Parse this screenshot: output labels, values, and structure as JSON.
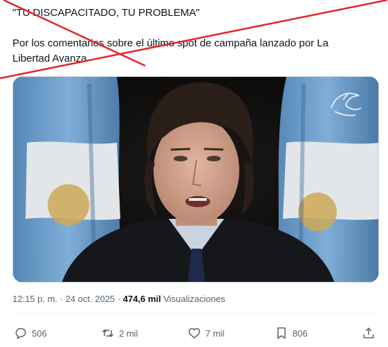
{
  "tweet": {
    "line1": "\"TU DISCAPACITADO, TU PROBLEMA\"",
    "line2": "Por los comentarios sobre el último spot de campaña lanzado por La",
    "line3": "Libertad Avanza"
  },
  "meta": {
    "timestamp": "12:15 p. m. · 24 oct. 2025",
    "separator": "·",
    "views_count": "474,6 mil",
    "views_label": "Visualizaciones"
  },
  "actions": {
    "replies": "506",
    "reposts": "2 mil",
    "likes": "7 mil",
    "bookmarks": "806"
  },
  "colors": {
    "stamp_red": "#e3262b",
    "flag_blue": "#74acdf",
    "meta_gray": "#536471"
  },
  "icons": [
    "reply-icon",
    "repost-icon",
    "like-icon",
    "bookmark-icon",
    "share-icon",
    "eagle-watermark-icon"
  ]
}
